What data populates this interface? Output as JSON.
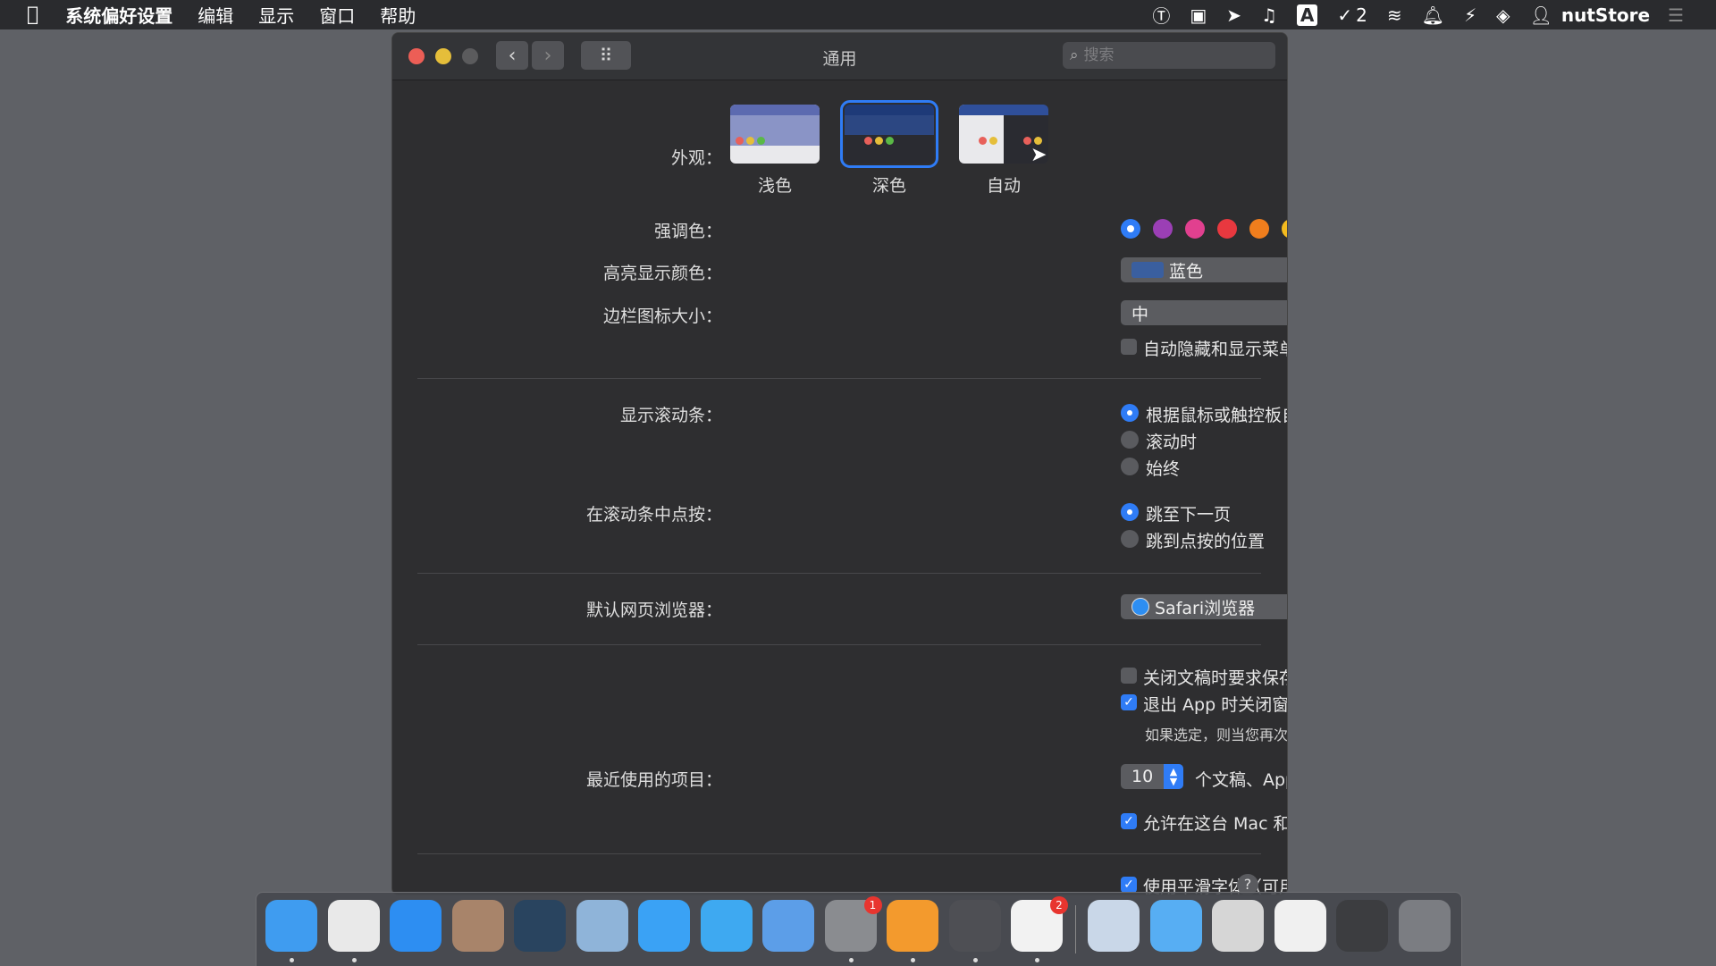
{
  "menubar": {
    "app_name": "系统偏好设置",
    "menus": [
      "编辑",
      "显示",
      "窗口",
      "帮助"
    ],
    "status_badge_count": "2",
    "input_method": "A",
    "user": "nutStore"
  },
  "window": {
    "title": "通用",
    "search_placeholder": "搜索"
  },
  "appearance": {
    "label": "外观：",
    "options": [
      "浅色",
      "深色",
      "自动"
    ],
    "selected": "深色"
  },
  "accent": {
    "label": "强调色：",
    "colors": [
      "#2f7cf6",
      "#9b3fb5",
      "#e1408f",
      "#e8383f",
      "#f07e1d",
      "#f4bb1f",
      "#5ab946",
      "#8c8c8c"
    ],
    "selected_index": 0
  },
  "highlight": {
    "label": "高亮显示颜色：",
    "value": "蓝色",
    "swatch": "#3a5f9f"
  },
  "sidebar_icon": {
    "label": "边栏图标大小：",
    "value": "中",
    "auto_hide_label": "自动隐藏和显示菜单栏",
    "auto_hide_checked": false
  },
  "scrollbars": {
    "label": "显示滚动条：",
    "options": [
      "根据鼠标或触控板自动显示",
      "滚动时",
      "始终"
    ],
    "selected_index": 0
  },
  "click_scrollbar": {
    "label": "在滚动条中点按：",
    "options": [
      "跳至下一页",
      "跳到点按的位置"
    ],
    "selected_index": 0
  },
  "browser": {
    "label": "默认网页浏览器：",
    "value": "Safari浏览器"
  },
  "documents": {
    "ask_save_label": "关闭文稿时要求保存更改",
    "ask_save_checked": false,
    "close_windows_label": "退出 App 时关闭窗口",
    "close_windows_checked": true,
    "close_windows_note": "如果选定，则当您再次打开 App 时就不会恢复已打开的文稿和窗口。"
  },
  "recent": {
    "label": "最近使用的项目：",
    "value": "10",
    "suffix": "个文稿、App 和服务器"
  },
  "handoff": {
    "label": "允许在这台 Mac 和 iCloud 设备之间使用“接力”",
    "checked": true
  },
  "smoothing": {
    "label": "使用平滑字体（可用时）",
    "checked": true
  },
  "help_glyph": "?",
  "dock": {
    "apps": [
      {
        "name": "finder",
        "color": "#3f9cf0",
        "running": true
      },
      {
        "name": "chrome",
        "color": "#e9e9e9",
        "running": true
      },
      {
        "name": "safari",
        "color": "#2d8ef2",
        "running": false
      },
      {
        "name": "calculator",
        "color": "#a8846a",
        "running": false
      },
      {
        "name": "screen-app",
        "color": "#29445f",
        "running": false
      },
      {
        "name": "preview",
        "color": "#8fb4d9",
        "running": false
      },
      {
        "name": "messages",
        "color": "#3aa2f5",
        "running": false
      },
      {
        "name": "numbers",
        "color": "#3ea9f1",
        "running": false
      },
      {
        "name": "keynote",
        "color": "#5c9ee8",
        "running": false
      },
      {
        "name": "system-preferences",
        "color": "#8a8c90",
        "running": true,
        "badge": "1"
      },
      {
        "name": "toolbox-app",
        "color": "#f39a2d",
        "running": true
      },
      {
        "name": "video-app",
        "color": "#4e4f54",
        "running": true
      },
      {
        "name": "tasks-app",
        "color": "#f2f2f2",
        "running": true,
        "badge": "2"
      }
    ],
    "folders": [
      {
        "name": "downloads-folder",
        "color": "#c9d7e8"
      },
      {
        "name": "folder",
        "color": "#57aef3"
      },
      {
        "name": "screenshot-stack",
        "color": "#d6d6d6"
      },
      {
        "name": "document-stack",
        "color": "#f0f0f0"
      },
      {
        "name": "media-stack",
        "color": "#3c3d40"
      },
      {
        "name": "trash",
        "color": "#7b7d82"
      }
    ]
  }
}
